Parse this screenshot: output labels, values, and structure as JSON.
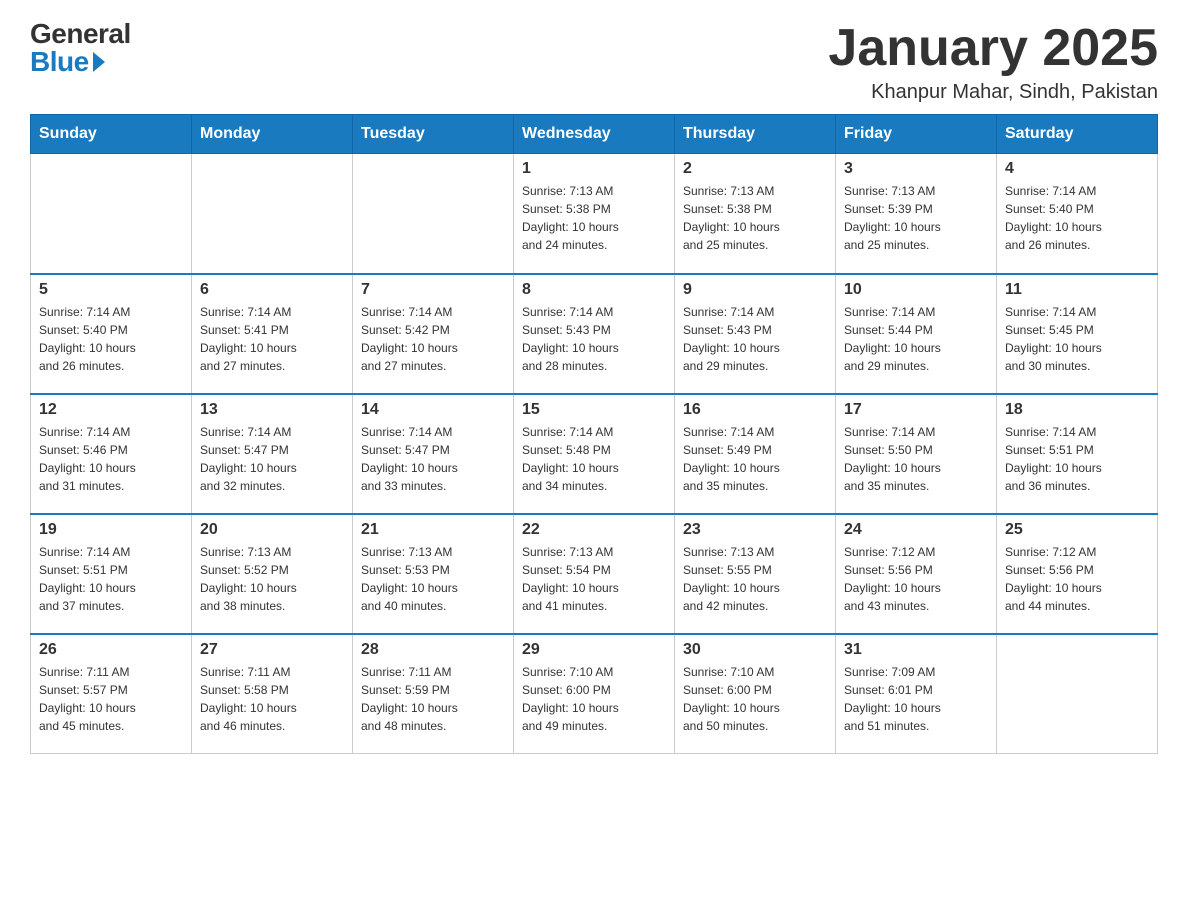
{
  "header": {
    "logo_general": "General",
    "logo_blue": "Blue",
    "month_title": "January 2025",
    "location": "Khanpur Mahar, Sindh, Pakistan"
  },
  "days_of_week": [
    "Sunday",
    "Monday",
    "Tuesday",
    "Wednesday",
    "Thursday",
    "Friday",
    "Saturday"
  ],
  "weeks": [
    [
      {
        "day": "",
        "info": ""
      },
      {
        "day": "",
        "info": ""
      },
      {
        "day": "",
        "info": ""
      },
      {
        "day": "1",
        "info": "Sunrise: 7:13 AM\nSunset: 5:38 PM\nDaylight: 10 hours\nand 24 minutes."
      },
      {
        "day": "2",
        "info": "Sunrise: 7:13 AM\nSunset: 5:38 PM\nDaylight: 10 hours\nand 25 minutes."
      },
      {
        "day": "3",
        "info": "Sunrise: 7:13 AM\nSunset: 5:39 PM\nDaylight: 10 hours\nand 25 minutes."
      },
      {
        "day": "4",
        "info": "Sunrise: 7:14 AM\nSunset: 5:40 PM\nDaylight: 10 hours\nand 26 minutes."
      }
    ],
    [
      {
        "day": "5",
        "info": "Sunrise: 7:14 AM\nSunset: 5:40 PM\nDaylight: 10 hours\nand 26 minutes."
      },
      {
        "day": "6",
        "info": "Sunrise: 7:14 AM\nSunset: 5:41 PM\nDaylight: 10 hours\nand 27 minutes."
      },
      {
        "day": "7",
        "info": "Sunrise: 7:14 AM\nSunset: 5:42 PM\nDaylight: 10 hours\nand 27 minutes."
      },
      {
        "day": "8",
        "info": "Sunrise: 7:14 AM\nSunset: 5:43 PM\nDaylight: 10 hours\nand 28 minutes."
      },
      {
        "day": "9",
        "info": "Sunrise: 7:14 AM\nSunset: 5:43 PM\nDaylight: 10 hours\nand 29 minutes."
      },
      {
        "day": "10",
        "info": "Sunrise: 7:14 AM\nSunset: 5:44 PM\nDaylight: 10 hours\nand 29 minutes."
      },
      {
        "day": "11",
        "info": "Sunrise: 7:14 AM\nSunset: 5:45 PM\nDaylight: 10 hours\nand 30 minutes."
      }
    ],
    [
      {
        "day": "12",
        "info": "Sunrise: 7:14 AM\nSunset: 5:46 PM\nDaylight: 10 hours\nand 31 minutes."
      },
      {
        "day": "13",
        "info": "Sunrise: 7:14 AM\nSunset: 5:47 PM\nDaylight: 10 hours\nand 32 minutes."
      },
      {
        "day": "14",
        "info": "Sunrise: 7:14 AM\nSunset: 5:47 PM\nDaylight: 10 hours\nand 33 minutes."
      },
      {
        "day": "15",
        "info": "Sunrise: 7:14 AM\nSunset: 5:48 PM\nDaylight: 10 hours\nand 34 minutes."
      },
      {
        "day": "16",
        "info": "Sunrise: 7:14 AM\nSunset: 5:49 PM\nDaylight: 10 hours\nand 35 minutes."
      },
      {
        "day": "17",
        "info": "Sunrise: 7:14 AM\nSunset: 5:50 PM\nDaylight: 10 hours\nand 35 minutes."
      },
      {
        "day": "18",
        "info": "Sunrise: 7:14 AM\nSunset: 5:51 PM\nDaylight: 10 hours\nand 36 minutes."
      }
    ],
    [
      {
        "day": "19",
        "info": "Sunrise: 7:14 AM\nSunset: 5:51 PM\nDaylight: 10 hours\nand 37 minutes."
      },
      {
        "day": "20",
        "info": "Sunrise: 7:13 AM\nSunset: 5:52 PM\nDaylight: 10 hours\nand 38 minutes."
      },
      {
        "day": "21",
        "info": "Sunrise: 7:13 AM\nSunset: 5:53 PM\nDaylight: 10 hours\nand 40 minutes."
      },
      {
        "day": "22",
        "info": "Sunrise: 7:13 AM\nSunset: 5:54 PM\nDaylight: 10 hours\nand 41 minutes."
      },
      {
        "day": "23",
        "info": "Sunrise: 7:13 AM\nSunset: 5:55 PM\nDaylight: 10 hours\nand 42 minutes."
      },
      {
        "day": "24",
        "info": "Sunrise: 7:12 AM\nSunset: 5:56 PM\nDaylight: 10 hours\nand 43 minutes."
      },
      {
        "day": "25",
        "info": "Sunrise: 7:12 AM\nSunset: 5:56 PM\nDaylight: 10 hours\nand 44 minutes."
      }
    ],
    [
      {
        "day": "26",
        "info": "Sunrise: 7:11 AM\nSunset: 5:57 PM\nDaylight: 10 hours\nand 45 minutes."
      },
      {
        "day": "27",
        "info": "Sunrise: 7:11 AM\nSunset: 5:58 PM\nDaylight: 10 hours\nand 46 minutes."
      },
      {
        "day": "28",
        "info": "Sunrise: 7:11 AM\nSunset: 5:59 PM\nDaylight: 10 hours\nand 48 minutes."
      },
      {
        "day": "29",
        "info": "Sunrise: 7:10 AM\nSunset: 6:00 PM\nDaylight: 10 hours\nand 49 minutes."
      },
      {
        "day": "30",
        "info": "Sunrise: 7:10 AM\nSunset: 6:00 PM\nDaylight: 10 hours\nand 50 minutes."
      },
      {
        "day": "31",
        "info": "Sunrise: 7:09 AM\nSunset: 6:01 PM\nDaylight: 10 hours\nand 51 minutes."
      },
      {
        "day": "",
        "info": ""
      }
    ]
  ]
}
